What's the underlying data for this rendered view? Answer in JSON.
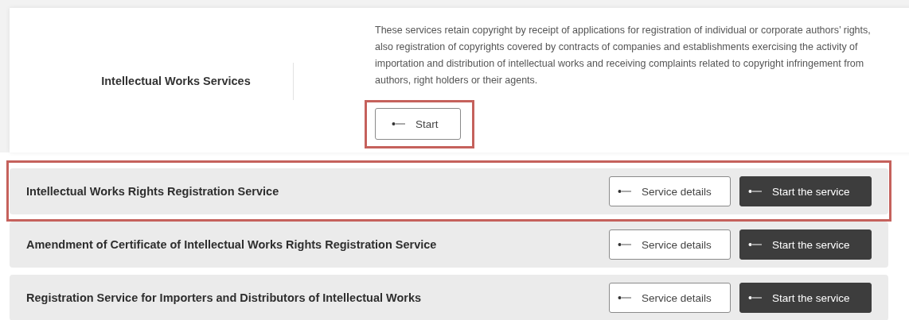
{
  "intro": {
    "title": "Intellectual Works Services",
    "description": "These services retain copyright by receipt of applications for registration of individual or corporate authors’ rights, also registration of copyrights covered by contracts of companies and establishments exercising the activity of importation and distribution of intellectual works and receiving complaints related to copyright infringement from authors, right holders or their agents.",
    "start_button": {
      "label": "Start",
      "highlighted": true
    }
  },
  "services": [
    {
      "title": "Intellectual Works Rights Registration Service",
      "highlighted": true,
      "details_button": "Service details",
      "start_button": "Start the service"
    },
    {
      "title": "Amendment of Certificate of Intellectual Works Rights Registration Service",
      "highlighted": false,
      "details_button": "Service details",
      "start_button": "Start the service"
    },
    {
      "title": "Registration Service for Importers and Distributors of Intellectual Works",
      "highlighted": false,
      "details_button": "Service details",
      "start_button": "Start the service"
    }
  ]
}
